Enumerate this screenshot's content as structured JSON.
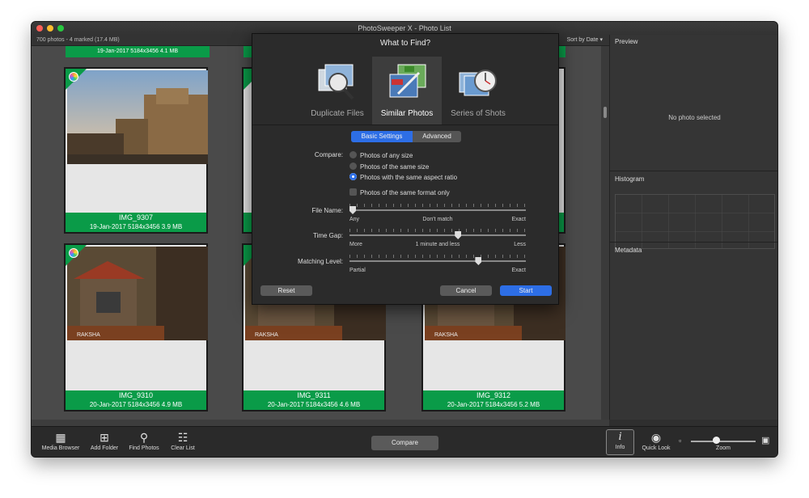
{
  "window": {
    "title": "PhotoSweeper X - Photo List"
  },
  "status": {
    "summary": "700 photos - 4 marked (17.4 MB)",
    "sort_label": "Sort by Date"
  },
  "top_partial": [
    {
      "caption": "19-Jan-2017   5184x3456   4.1 MB"
    }
  ],
  "photos": [
    {
      "name": "IMG_9307",
      "details": "19-Jan-2017   5184x3456   3.9 MB"
    },
    {
      "name": "IMG_9310",
      "details": "20-Jan-2017   5184x3456   4.9 MB"
    },
    {
      "name": "IMG_9311",
      "details": "20-Jan-2017   5184x3456   4.6 MB"
    },
    {
      "name": "IMG_9312",
      "details": "20-Jan-2017   5184x3456   5.2 MB"
    }
  ],
  "right_panel": {
    "preview_title": "Preview",
    "no_photo": "No photo selected",
    "histogram_title": "Histogram",
    "metadata_title": "Metadata"
  },
  "toolbar": {
    "media_browser": "Media Browser",
    "add_folder": "Add Folder",
    "find_photos": "Find Photos",
    "clear_list": "Clear List",
    "compare": "Compare",
    "info": "Info",
    "quick_look": "Quick Look",
    "zoom": "Zoom"
  },
  "dialog": {
    "title": "What to Find?",
    "modes": [
      "Duplicate Files",
      "Similar Photos",
      "Series of Shots"
    ],
    "active_mode": "Similar Photos",
    "tabs": [
      "Basic Settings",
      "Advanced"
    ],
    "active_tab": "Basic Settings",
    "compare_label": "Compare:",
    "compare_options": [
      "Photos of any size",
      "Photos of the same size",
      "Photos with the same aspect ratio"
    ],
    "compare_selected": "Photos with the same aspect ratio",
    "same_format": {
      "label": "Photos of the same format only",
      "checked": false
    },
    "file_name": {
      "label": "File Name:",
      "left": "Any",
      "mid": "Don't match",
      "right": "Exact",
      "level": 0.0
    },
    "time_gap": {
      "label": "Time Gap:",
      "left": "More",
      "mid": "1 minute and less",
      "right": "Less",
      "level": 0.62
    },
    "matching_level": {
      "label": "Matching Level:",
      "left": "Partial",
      "right": "Exact",
      "level": 0.74
    },
    "buttons": {
      "reset": "Reset",
      "cancel": "Cancel",
      "start": "Start"
    }
  },
  "colors": {
    "accent": "#2d6ee6",
    "marked_green": "#0a9b48"
  }
}
